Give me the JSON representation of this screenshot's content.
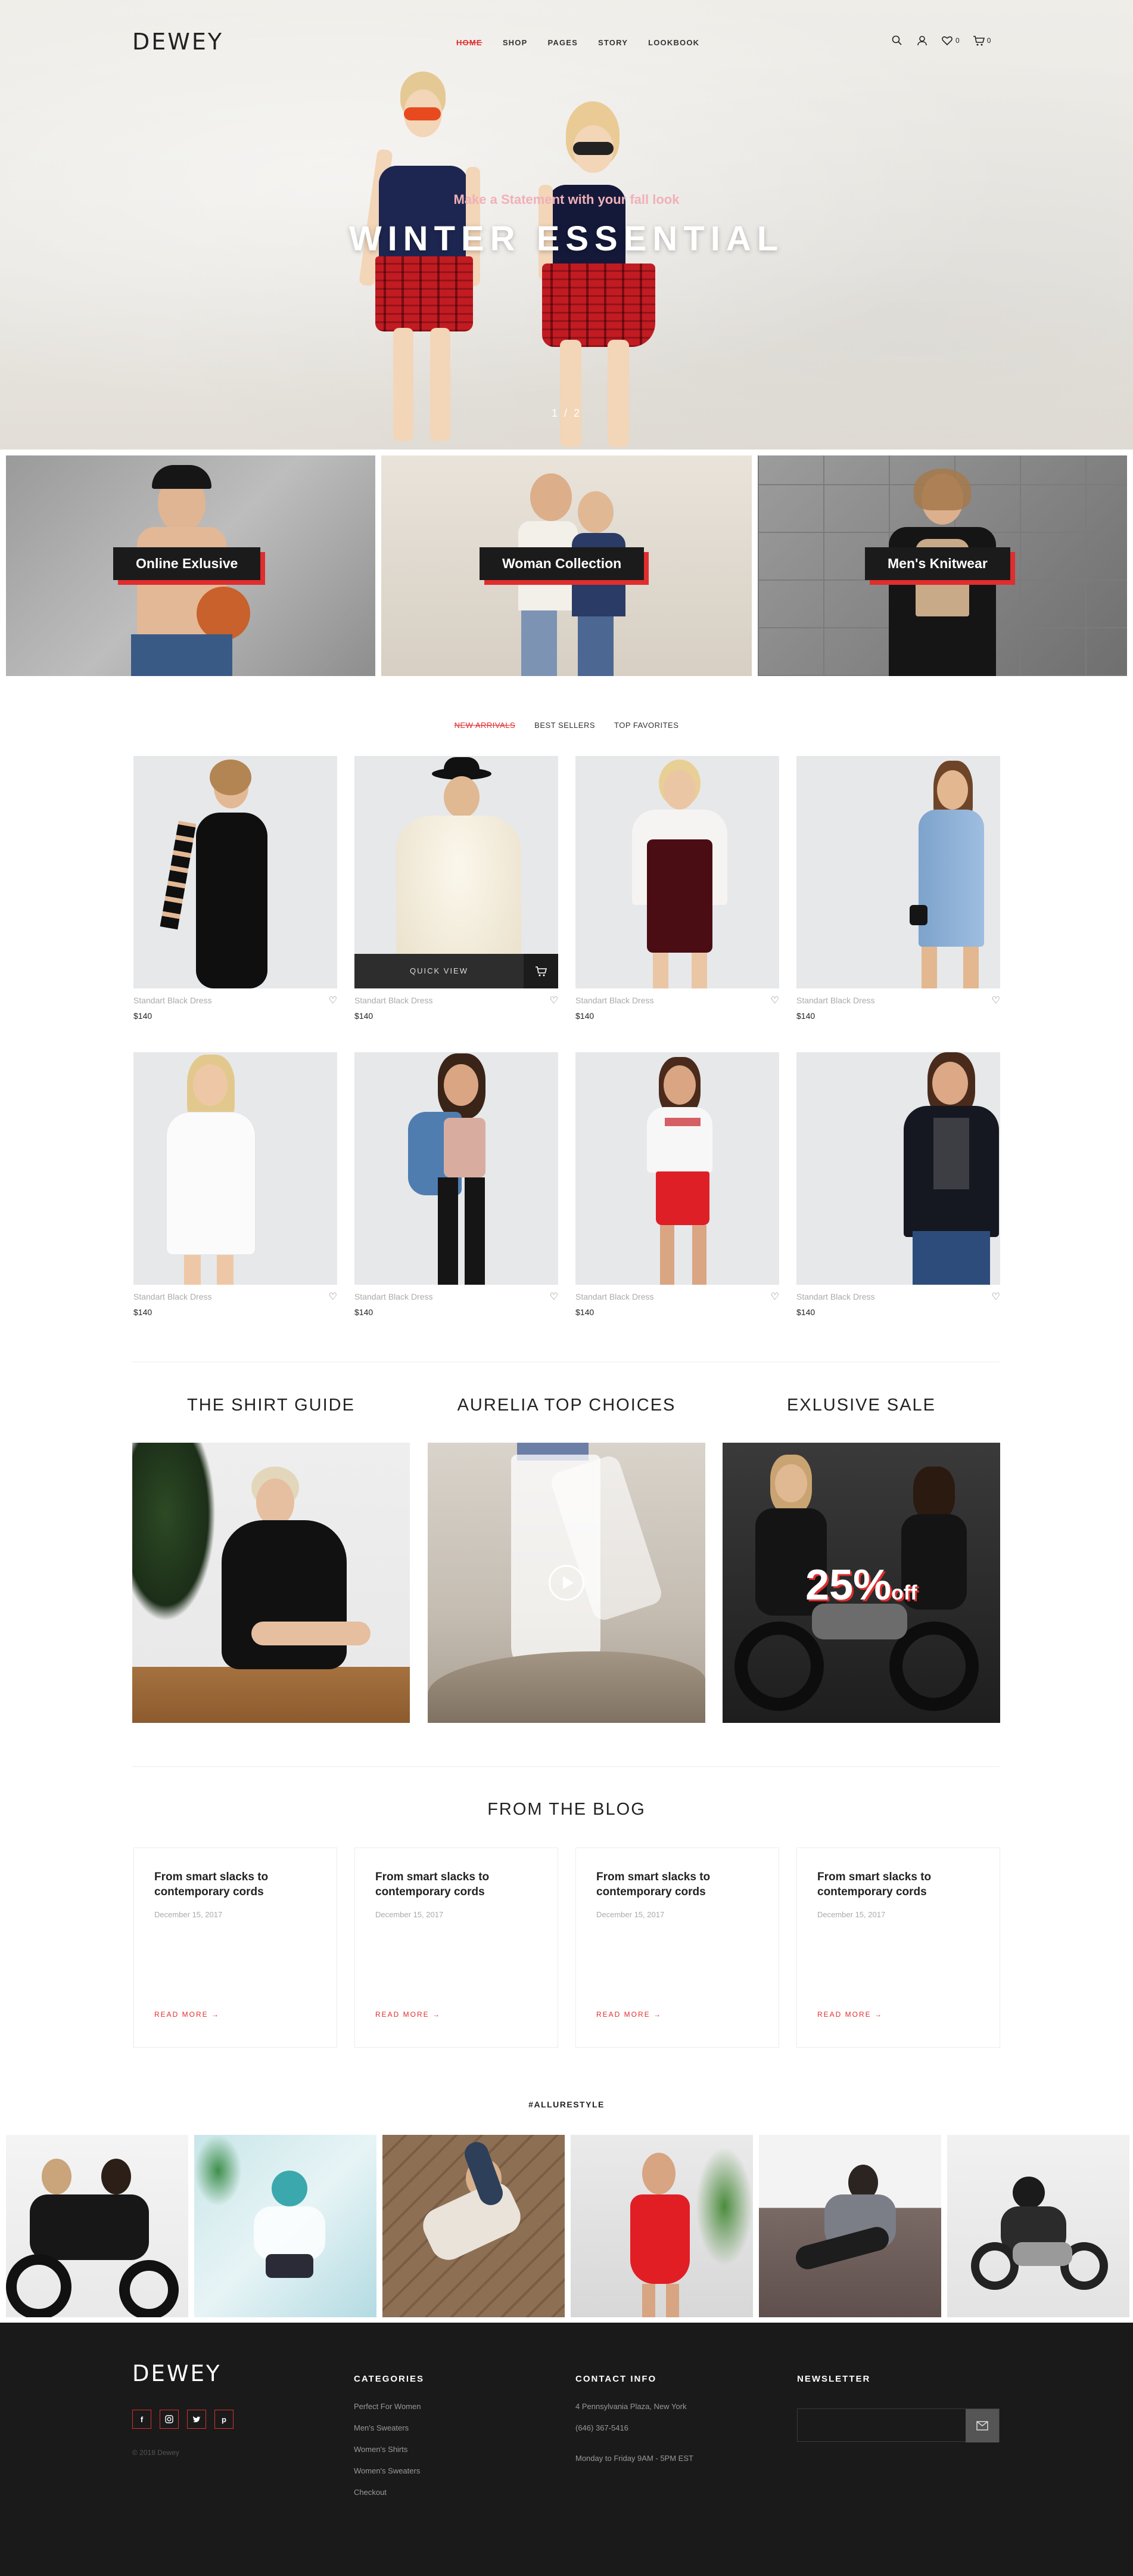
{
  "brand": {
    "logo": "DEWEY"
  },
  "nav": {
    "items": [
      "HOME",
      "SHOP",
      "PAGES",
      "STORY",
      "LOOKBOOK"
    ],
    "wishlist_count": "0",
    "cart_count": "0"
  },
  "hero": {
    "subtitle": "Make a Statement with your fall look",
    "title": "WINTER ESSENTIAL",
    "pager": "1 / 2"
  },
  "categories": [
    "Online Exlusive",
    "Woman Collection",
    "Men's Knitwear"
  ],
  "tabs": [
    "NEW ARRIVALS",
    "BEST SELLERS",
    "TOP FAVORITES"
  ],
  "products": [
    {
      "name": "Standart Black Dress",
      "price": "$140"
    },
    {
      "name": "Standart Black Dress",
      "price": "$140"
    },
    {
      "name": "Standart Black Dress",
      "price": "$140"
    },
    {
      "name": "Standart Black Dress",
      "price": "$140"
    },
    {
      "name": "Standart Black Dress",
      "price": "$140"
    },
    {
      "name": "Standart Black Dress",
      "price": "$140"
    },
    {
      "name": "Standart Black Dress",
      "price": "$140"
    },
    {
      "name": "Standart Black Dress",
      "price": "$140"
    }
  ],
  "quick_view_label": "QUICK VIEW",
  "collections": [
    {
      "title": "THE SHIRT GUIDE"
    },
    {
      "title": "AURELIA TOP CHOICES"
    },
    {
      "title": "EXLUSIVE SALE",
      "sale_value": "25%",
      "sale_suffix": "off"
    }
  ],
  "blog": {
    "title": "FROM THE BLOG",
    "posts": [
      {
        "title": "From smart slacks to contemporary cords",
        "date": "December 15, 2017",
        "read_more": "READ MORE"
      },
      {
        "title": "From smart slacks to contemporary cords",
        "date": "December 15, 2017",
        "read_more": "READ MORE"
      },
      {
        "title": "From smart slacks to contemporary cords",
        "date": "December 15, 2017",
        "read_more": "READ MORE"
      },
      {
        "title": "From smart slacks to contemporary cords",
        "date": "December 15, 2017",
        "read_more": "READ MORE"
      }
    ]
  },
  "instagram": {
    "tag": "#ALLURESTYLE"
  },
  "footer": {
    "logo": "DEWEY",
    "socials": [
      "f",
      "ig",
      "tw",
      "p"
    ],
    "copyright": "© 2018 Dewey",
    "categories": {
      "heading": "CATEGORIES",
      "items": [
        "Perfect For Women",
        "Men's Sweaters",
        "Women's Shirts",
        "Women's Sweaters",
        "Checkout"
      ]
    },
    "contact": {
      "heading": "CONTACT INFO",
      "address": "4 Pennsylvania Plaza, New York",
      "phone": "(646) 367-5416",
      "hours": "Monday to Friday 9AM - 5PM EST"
    },
    "newsletter": {
      "heading": "NEWSLETTER",
      "placeholder": ""
    }
  },
  "colors": {
    "accent": "#e02d2d",
    "dark": "#1a1a1a",
    "navy": "#1d2650"
  }
}
